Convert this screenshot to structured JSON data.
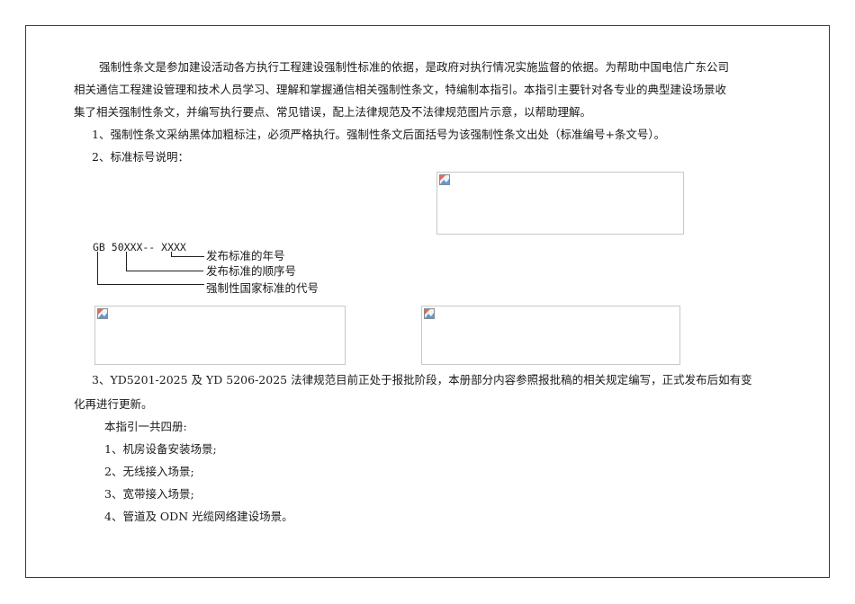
{
  "intro": {
    "line1": "强制性条文是参加建设活动各方执行工程建设强制性标准的依据，是政府对执行情况实施监督的依据。为帮助中国电信广东公司",
    "line2": "相关通信工程建设管理和技术人员学习、理解和掌握通信相关强制性条文，特编制本指引。本指引主要针对各专业的典型建设场景收",
    "line3": "集了相关强制性条文，并编写执行要点、常见错误，配上法律规范及不法律规范图片示意，以帮助理解。"
  },
  "item1": "1、强制性条文采纳黑体加粗标注，必须严格执行。强制性条文后面括号为该强制性条文出处（标准编号+条文号）。",
  "item2": "2、标准标号说明：",
  "diagram": {
    "code": "GB  50XXX-- XXXX",
    "label_year": "发布标准的年号",
    "label_seq": "发布标准的顺序号",
    "label_code": "强制性国家标准的代号"
  },
  "item3": {
    "line1": "3、YD5201-2025 及 YD 5206-2025 法律规范目前正处于报批阶段，本册部分内容参照报批稿的相关规定编写，正式发布后如有变",
    "line2": "化再进行更新。"
  },
  "volumes": {
    "title": "本指引一共四册:",
    "items": [
      "1、机房设备安装场景;",
      "2、无线接入场景;",
      "3、宽带接入场景;",
      "4、管道及 ODN 光缆网络建设场景。"
    ]
  },
  "colors": {
    "border": "#3a3a3a",
    "text": "#1a1a1a",
    "placeholder_border": "#c8c8c8"
  },
  "icons": [
    "broken-image-icon"
  ]
}
